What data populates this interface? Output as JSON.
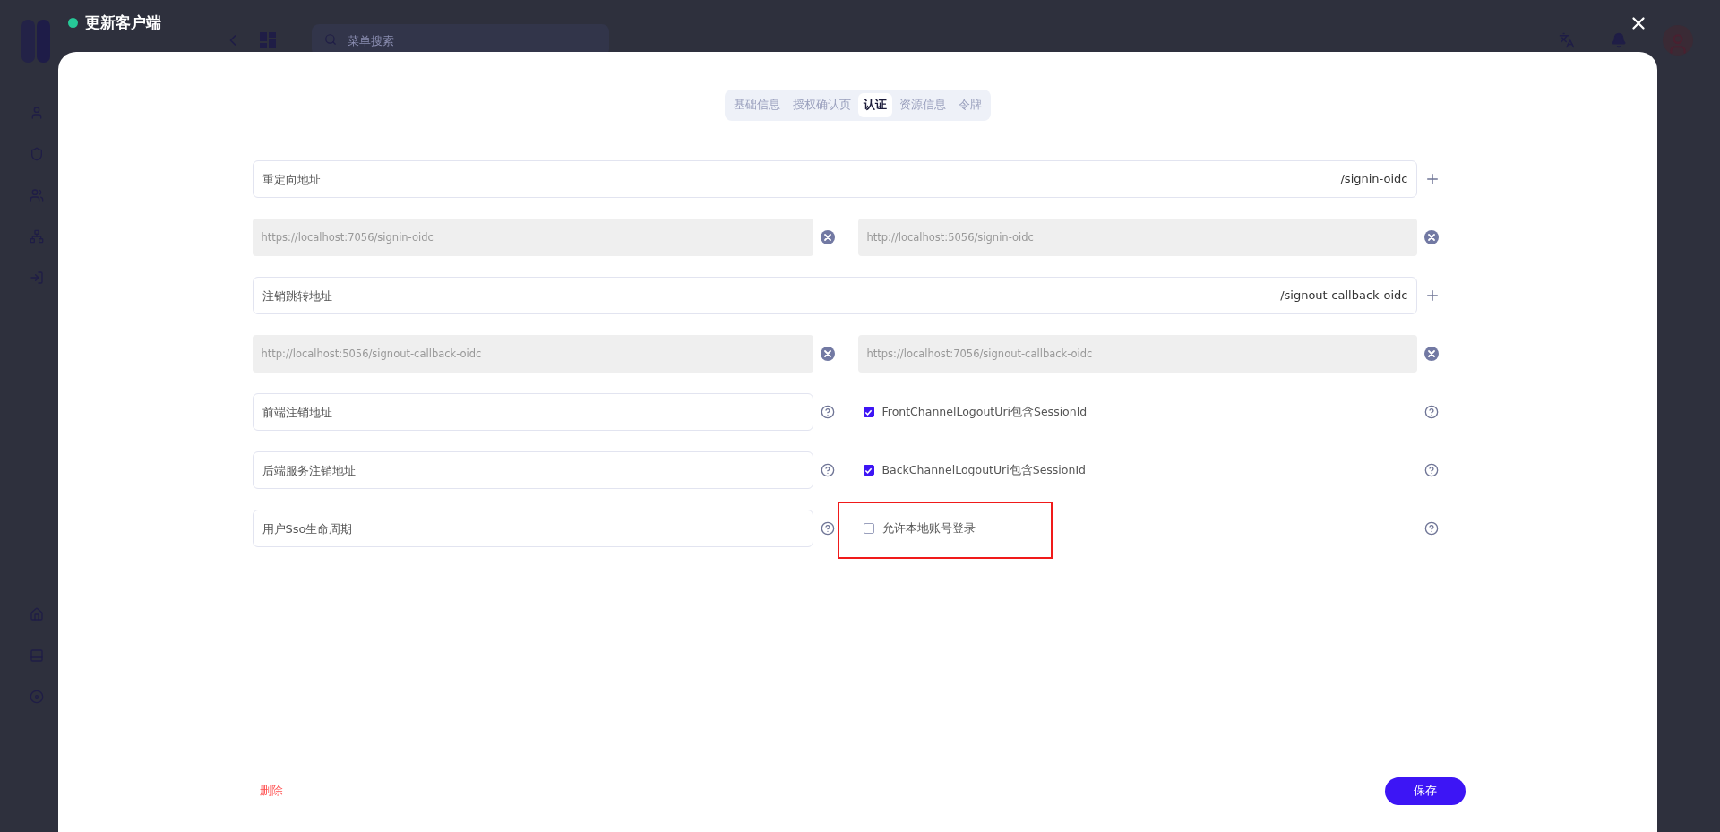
{
  "background_app": {
    "search": {
      "placeholder": "菜单搜索"
    }
  },
  "dialog": {
    "title": "更新客户端",
    "tabs": [
      {
        "label": "基础信息",
        "selected": false
      },
      {
        "label": "授权确认页",
        "selected": false
      },
      {
        "label": "认证",
        "selected": true
      },
      {
        "label": "资源信息",
        "selected": false
      },
      {
        "label": "令牌",
        "selected": false
      }
    ],
    "uri_groups": [
      {
        "placeholder": "重定向地址",
        "suffix": "/signin-oidc",
        "uris": [
          "https://localhost:7056/signin-oidc",
          "http://localhost:5056/signin-oidc"
        ]
      },
      {
        "placeholder": "注销跳转地址",
        "suffix": "/signout-callback-oidc",
        "uris": [
          "http://localhost:5056/signout-callback-oidc",
          "https://localhost:7056/signout-callback-oidc"
        ]
      }
    ],
    "settings": [
      {
        "field": {
          "placeholder": "前端注销地址"
        },
        "option": {
          "label": "FrontChannelLogoutUri包含SessionId",
          "checked": true,
          "highlighted": false
        }
      },
      {
        "field": {
          "placeholder": "后端服务注销地址"
        },
        "option": {
          "label": "BackChannelLogoutUri包含SessionId",
          "checked": true,
          "highlighted": false
        }
      },
      {
        "field": {
          "placeholder": "用户Sso生命周期"
        },
        "option": {
          "label": "允许本地账号登录",
          "checked": false,
          "highlighted": true
        }
      }
    ],
    "actions": {
      "delete": "删除",
      "save": "保存"
    }
  }
}
